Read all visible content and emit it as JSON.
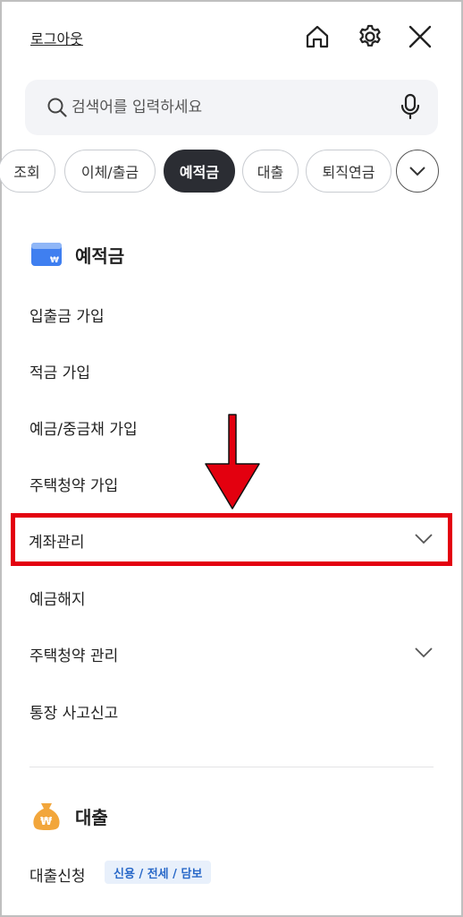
{
  "header": {
    "logout_label": "로그아웃",
    "icons": [
      "home-icon",
      "gear-icon",
      "close-icon"
    ]
  },
  "search": {
    "placeholder": "검색어를 입력하세요",
    "icon": "search-icon",
    "mic_icon": "microphone-icon"
  },
  "tabs": [
    {
      "label": "조회",
      "active": false
    },
    {
      "label": "이체/출금",
      "active": false
    },
    {
      "label": "예적금",
      "active": true
    },
    {
      "label": "대출",
      "active": false
    },
    {
      "label": "퇴직연금",
      "active": false
    }
  ],
  "sections": {
    "deposit": {
      "title": "예적금",
      "icon": "deposit-card-icon",
      "items": [
        {
          "label": "입출금 가입"
        },
        {
          "label": "적금 가입"
        },
        {
          "label": "예금/중금채 가입"
        },
        {
          "label": "주택청약 가입"
        },
        {
          "label": "계좌관리",
          "expandable": true
        },
        {
          "label": "예금해지"
        },
        {
          "label": "주택청약 관리",
          "expandable": true
        },
        {
          "label": "통장 사고신고"
        }
      ]
    },
    "loan": {
      "title": "대출",
      "icon": "money-bag-icon",
      "items": [
        {
          "label": "대출신청",
          "badge": "신용 / 전세 / 담보"
        }
      ]
    }
  },
  "colors": {
    "active_tab": "#2b2d33",
    "highlight": "#e3000f",
    "badge_text": "#2868c8",
    "badge_bg": "#e8f0fb"
  }
}
